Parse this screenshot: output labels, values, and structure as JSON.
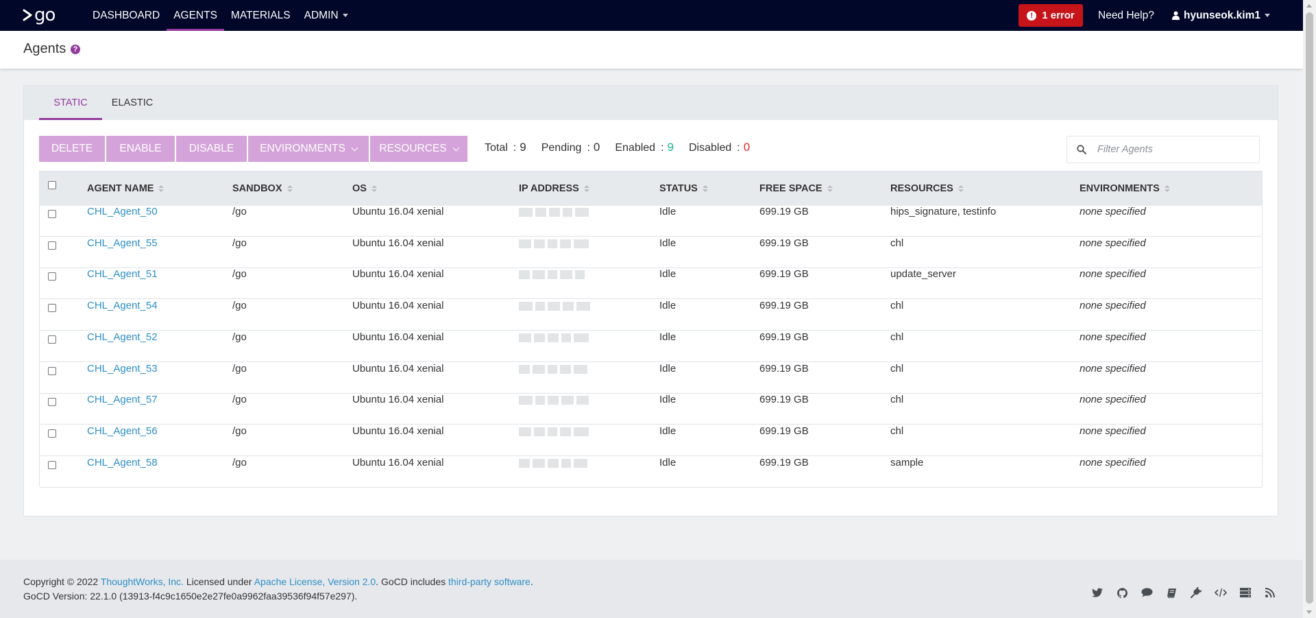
{
  "brand": {
    "logo_text": "go"
  },
  "nav": {
    "links": [
      {
        "label": "DASHBOARD",
        "active": false
      },
      {
        "label": "AGENTS",
        "active": true
      },
      {
        "label": "MATERIALS",
        "active": false
      },
      {
        "label": "ADMIN",
        "active": false
      }
    ],
    "error_badge": "1 error",
    "help": "Need Help?",
    "user": "hyunseok.kim1",
    "active_color": "#943a9e"
  },
  "page": {
    "title": "Agents",
    "help_icon": "?"
  },
  "tabs": [
    {
      "label": "STATIC",
      "active": true
    },
    {
      "label": "ELASTIC",
      "active": false
    }
  ],
  "actions": {
    "delete": "DELETE",
    "enable": "ENABLE",
    "disable": "DISABLE",
    "environments": "ENVIRONMENTS",
    "resources": "RESOURCES"
  },
  "counts": {
    "total_label": "Total",
    "total": "9",
    "pending_label": "Pending",
    "pending": "0",
    "enabled_label": "Enabled",
    "enabled": "9",
    "disabled_label": "Disabled",
    "disabled": "0",
    "separator": ":"
  },
  "filter": {
    "placeholder": "Filter Agents",
    "value": ""
  },
  "table": {
    "columns": [
      "AGENT NAME",
      "SANDBOX",
      "OS",
      "IP ADDRESS",
      "STATUS",
      "FREE SPACE",
      "RESOURCES",
      "ENVIRONMENTS"
    ],
    "rows": [
      {
        "name": "CHL_Agent_50",
        "sandbox": "/go",
        "os": "Ubuntu 16.04 xenial",
        "status": "Idle",
        "free_space": "699.19 GB",
        "resources": "hips_signature, testinfo",
        "environments": "none specified"
      },
      {
        "name": "CHL_Agent_55",
        "sandbox": "/go",
        "os": "Ubuntu 16.04 xenial",
        "status": "Idle",
        "free_space": "699.19 GB",
        "resources": "chl",
        "environments": "none specified"
      },
      {
        "name": "CHL_Agent_51",
        "sandbox": "/go",
        "os": "Ubuntu 16.04 xenial",
        "status": "Idle",
        "free_space": "699.19 GB",
        "resources": "update_server",
        "environments": "none specified"
      },
      {
        "name": "CHL_Agent_54",
        "sandbox": "/go",
        "os": "Ubuntu 16.04 xenial",
        "status": "Idle",
        "free_space": "699.19 GB",
        "resources": "chl",
        "environments": "none specified"
      },
      {
        "name": "CHL_Agent_52",
        "sandbox": "/go",
        "os": "Ubuntu 16.04 xenial",
        "status": "Idle",
        "free_space": "699.19 GB",
        "resources": "chl",
        "environments": "none specified"
      },
      {
        "name": "CHL_Agent_53",
        "sandbox": "/go",
        "os": "Ubuntu 16.04 xenial",
        "status": "Idle",
        "free_space": "699.19 GB",
        "resources": "chl",
        "environments": "none specified"
      },
      {
        "name": "CHL_Agent_57",
        "sandbox": "/go",
        "os": "Ubuntu 16.04 xenial",
        "status": "Idle",
        "free_space": "699.19 GB",
        "resources": "chl",
        "environments": "none specified"
      },
      {
        "name": "CHL_Agent_56",
        "sandbox": "/go",
        "os": "Ubuntu 16.04 xenial",
        "status": "Idle",
        "free_space": "699.19 GB",
        "resources": "chl",
        "environments": "none specified"
      },
      {
        "name": "CHL_Agent_58",
        "sandbox": "/go",
        "os": "Ubuntu 16.04 xenial",
        "status": "Idle",
        "free_space": "699.19 GB",
        "resources": "sample",
        "environments": "none specified"
      }
    ]
  },
  "footer": {
    "copyright": "Copyright © 2022",
    "company": "ThoughtWorks, Inc.",
    "licensed_under": "Licensed under",
    "license": "Apache License, Version 2.0",
    "includes": ". GoCD includes",
    "third_party": "third-party software",
    "period": ".",
    "version": "GoCD Version: 22.1.0 (13913-f4c9c1650e2e27fe0a9962faa39536f94f57e297).",
    "icons": [
      "twitter-icon",
      "github-icon",
      "chat-icon",
      "book-icon",
      "plugin-icon",
      "code-icon",
      "server-icon",
      "rss-icon"
    ]
  },
  "colors": {
    "nav_bg": "#000728",
    "accent": "#943a9e",
    "button": "#d3a3d9",
    "link": "#2d8ec7",
    "error": "#c7141a",
    "enabled_count": "#20b38d",
    "disabled_count": "#e0262b"
  }
}
